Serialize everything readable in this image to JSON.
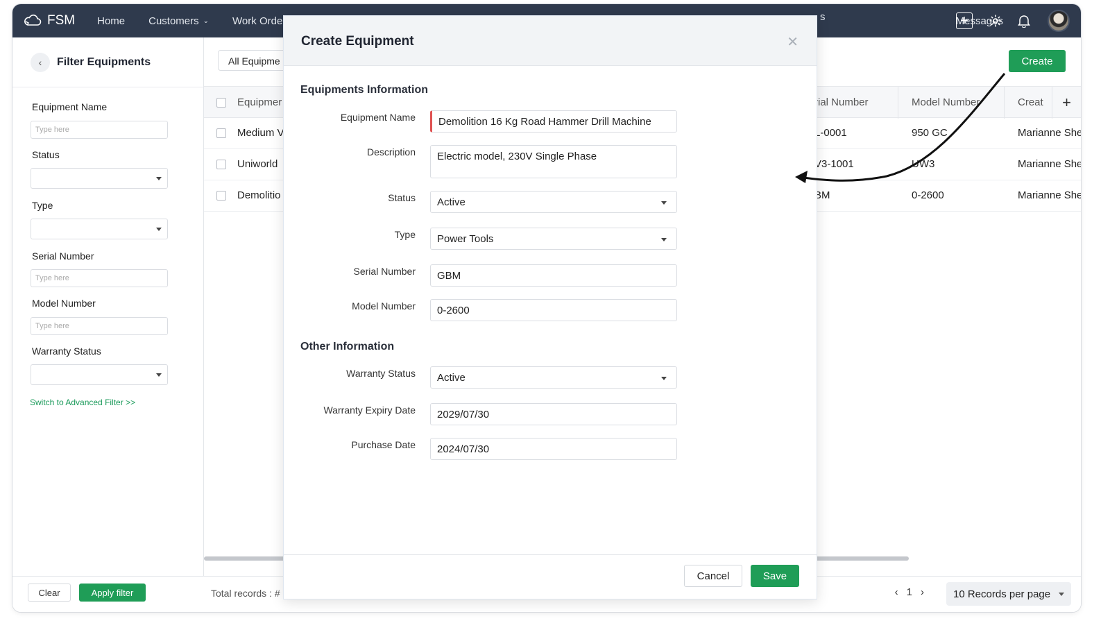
{
  "nav": {
    "logo": "FSM",
    "items": [
      {
        "label": "Home"
      },
      {
        "label": "Customers"
      },
      {
        "label": "Work Order"
      }
    ],
    "trail_fragment": "s",
    "messages": "Messages"
  },
  "sidebar": {
    "title": "Filter Equipments",
    "fields": {
      "equipment_name": {
        "label": "Equipment Name",
        "placeholder": "Type here"
      },
      "status": {
        "label": "Status",
        "value": ""
      },
      "type": {
        "label": "Type",
        "value": ""
      },
      "serial_number": {
        "label": "Serial Number",
        "placeholder": "Type here"
      },
      "model_number": {
        "label": "Model Number",
        "placeholder": "Type here"
      },
      "warranty_status": {
        "label": "Warranty Status",
        "value": ""
      }
    },
    "advanced_link": "Switch to Advanced Filter >>",
    "clear_label": "Clear",
    "apply_label": "Apply filter"
  },
  "list": {
    "view_select": "All Equipme",
    "create_label": "Create",
    "columns": {
      "equipment": "Equipmer",
      "serial": "rial Number",
      "model": "Model Number",
      "created": "Creat"
    },
    "add_column_icon": "+",
    "rows": [
      {
        "name": "Medium V",
        "serial": "L-0001",
        "model": "950 GC",
        "created_by": "Marianne She"
      },
      {
        "name": "Uniworld",
        "serial": "V3-1001",
        "model": "UW3",
        "created_by": "Marianne She"
      },
      {
        "name": "Demolitio",
        "serial": "BM",
        "model": "0-2600",
        "created_by": "Marianne She"
      }
    ],
    "total_records": "Total records : #",
    "page_number": "1",
    "records_per_page": "10 Records per page"
  },
  "modal": {
    "title": "Create Equipment",
    "section_equipment": "Equipments Information",
    "section_other": "Other Information",
    "fields": {
      "equipment_name": {
        "label": "Equipment Name",
        "value": "Demolition 16 Kg Road Hammer Drill Machine"
      },
      "description": {
        "label": "Description",
        "value": "Electric model, 230V Single Phase"
      },
      "status": {
        "label": "Status",
        "value": "Active"
      },
      "type": {
        "label": "Type",
        "value": "Power Tools"
      },
      "serial_number": {
        "label": "Serial Number",
        "value": "GBM"
      },
      "model_number": {
        "label": "Model Number",
        "value": "0-2600"
      },
      "warranty_status": {
        "label": "Warranty Status",
        "value": "Active"
      },
      "warranty_expiry_date": {
        "label": "Warranty Expiry Date",
        "value": "2029/07/30"
      },
      "purchase_date": {
        "label": "Purchase Date",
        "value": "2024/07/30"
      }
    },
    "cancel_label": "Cancel",
    "save_label": "Save"
  },
  "colors": {
    "nav_bg": "#2f3a4d",
    "primary_green": "#1f9d57",
    "required_marker": "#e05252"
  }
}
